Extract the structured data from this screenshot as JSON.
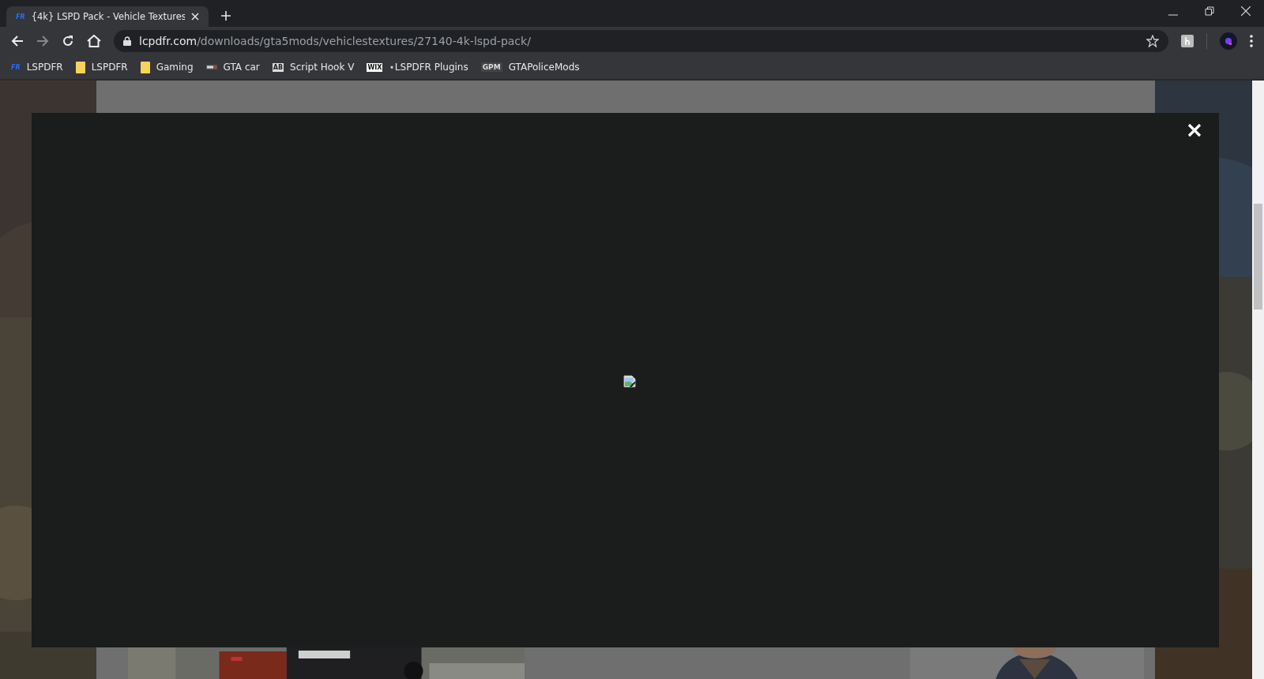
{
  "tab": {
    "favicon": "FR",
    "title": "{4k} LSPD Pack - Vehicle Textures",
    "selected": true
  },
  "address": {
    "domain": "lcpdfr.com",
    "path": "/downloads/gta5mods/vehiclestextures/27140-4k-lspd-pack/"
  },
  "bookmarks": [
    {
      "kind": "text",
      "favicon": "FR",
      "label": "LSPDFR"
    },
    {
      "kind": "folder",
      "label": "LSPDFR"
    },
    {
      "kind": "folder",
      "label": "Gaming"
    },
    {
      "kind": "car",
      "label": "GTA car"
    },
    {
      "kind": "text",
      "favicon": "AB",
      "label": "Script Hook V"
    },
    {
      "kind": "text",
      "favicon": "WIX",
      "label": "⋆LSPDFR Plugins"
    },
    {
      "kind": "text",
      "favicon": "GPM",
      "label": "GTAPoliceMods"
    }
  ]
}
